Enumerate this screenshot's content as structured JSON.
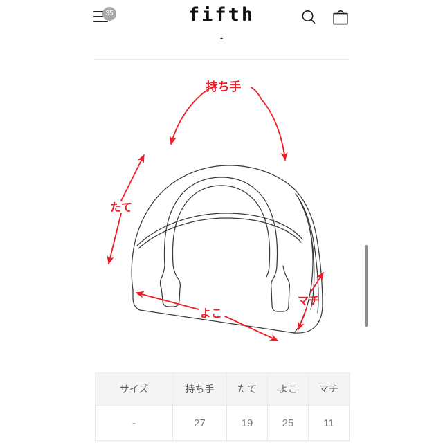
{
  "header": {
    "menu_icon": "hamburger-menu-icon",
    "menu_badge": "35",
    "logo": "fifth",
    "logo_subtitle": "-",
    "search_icon": "search-icon",
    "cart_icon": "shopping-bag-icon"
  },
  "illustration": {
    "alt": "handbag-size-diagram",
    "accent_color": "#ee1c25",
    "line_color": "#3a3a3a",
    "labels": {
      "handle": "持ち手",
      "height": "たて",
      "width": "よこ",
      "depth": "マチ"
    }
  },
  "size_table": {
    "headers": [
      "サイズ",
      "持ち手",
      "たて",
      "よこ",
      "マチ",
      ""
    ],
    "rows": [
      [
        "-",
        "27",
        "19",
        "25",
        "11",
        ""
      ]
    ]
  },
  "scrollbar": {
    "thumb": "vertical-scrollbar-thumb"
  }
}
